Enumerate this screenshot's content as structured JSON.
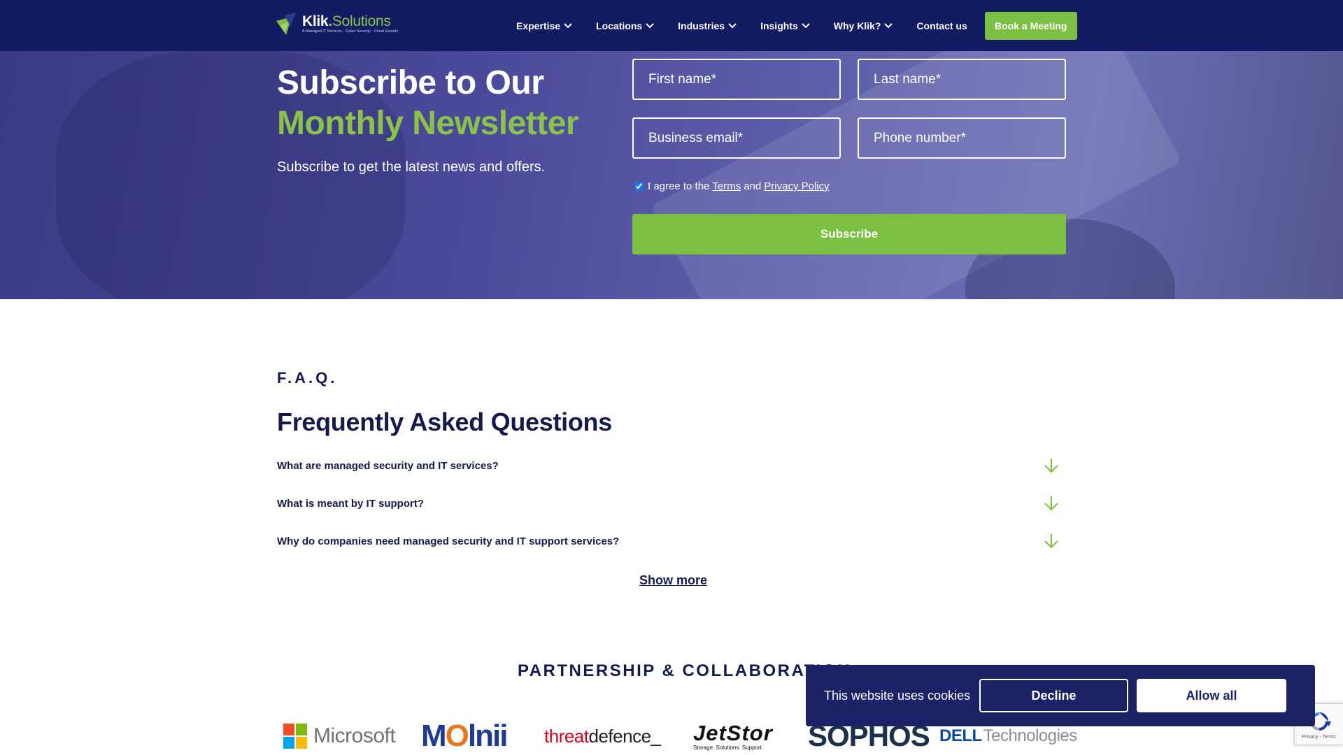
{
  "header": {
    "logo_name_a": "Klik",
    "logo_name_dot": ".",
    "logo_name_b": "Solutions",
    "logo_tagline": "A Managed IT Services · Cyber Security · Cloud Experts",
    "nav": [
      {
        "label": "Expertise",
        "has_dropdown": true
      },
      {
        "label": "Locations",
        "has_dropdown": true
      },
      {
        "label": "Industries",
        "has_dropdown": true
      },
      {
        "label": "Insights",
        "has_dropdown": true
      },
      {
        "label": "Why Klik?",
        "has_dropdown": true
      },
      {
        "label": "Contact us",
        "has_dropdown": false
      }
    ],
    "cta_label": "Book a Meeting"
  },
  "newsletter": {
    "title_line1": "Subscribe to Our",
    "title_line2": "Monthly Newsletter",
    "subtitle": "Subscribe to get the latest news and offers.",
    "first_name_placeholder": "First name*",
    "last_name_placeholder": "Last name*",
    "email_placeholder": "Business email*",
    "phone_placeholder": "Phone number*",
    "agree_prefix": "I agree to the",
    "terms_label": "Terms",
    "agree_and": "and",
    "privacy_label": "Privacy Policy",
    "agree_checked": true,
    "subscribe_label": "Subscribe"
  },
  "faq": {
    "eyebrow": "F.A.Q.",
    "title": "Frequently Asked Questions",
    "questions": [
      "What are managed security and IT services?",
      "What is meant by IT support?",
      "Why do companies need managed security and IT support services?"
    ],
    "show_more_label": "Show more"
  },
  "partners": {
    "title": "PARTNERSHIP & COLLABORATION",
    "logos": {
      "microsoft": "Microsoft",
      "molnii_a": "M",
      "molnii_o": "O",
      "molnii_b": "lnii",
      "threat_a": "threat",
      "threat_b": "defence_",
      "jetstor": "JetStor",
      "jetstor_tag": "Storage. Solutions. Support.",
      "sophos": "SOPHOS",
      "dell_a": "DELL",
      "dell_b": "Technologies"
    }
  },
  "cookie_banner": {
    "text": "This website uses cookies",
    "decline_label": "Decline",
    "allow_label": "Allow all"
  },
  "recaptcha": {
    "links": "Privacy - Terms"
  },
  "colors": {
    "navy": "#131b63",
    "green": "#7cc043",
    "text_dark": "#141a4a",
    "cookie_bg": "#1b2266"
  },
  "icons": [
    "logo-mark-icon",
    "chevron-down-icon",
    "arrow-down-icon",
    "microsoft-grid-icon",
    "recaptcha-icon"
  ]
}
